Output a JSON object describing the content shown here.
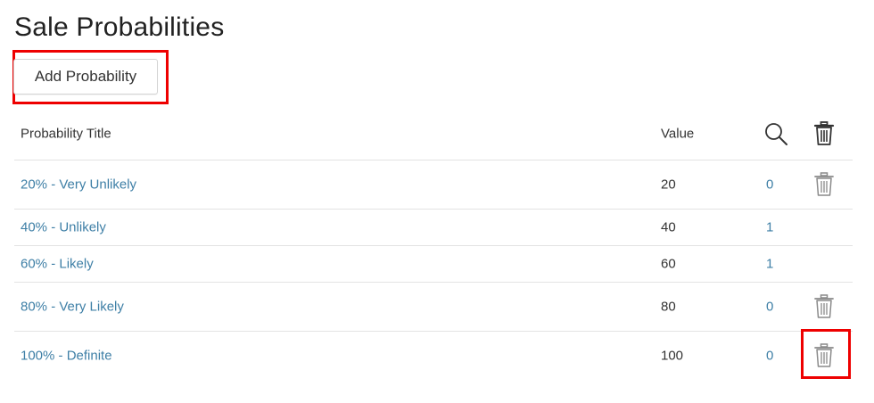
{
  "page": {
    "title": "Sale Probabilities"
  },
  "toolbar": {
    "add_label": "Add Probability"
  },
  "table": {
    "headers": {
      "title": "Probability Title",
      "value": "Value"
    },
    "rows": [
      {
        "title": "20% - Very Unlikely",
        "value": "20",
        "count": "0",
        "deletable": true
      },
      {
        "title": "40% - Unlikely",
        "value": "40",
        "count": "1",
        "deletable": false
      },
      {
        "title": "60% - Likely",
        "value": "60",
        "count": "1",
        "deletable": false
      },
      {
        "title": "80% - Very Likely",
        "value": "80",
        "count": "0",
        "deletable": true
      },
      {
        "title": "100% - Definite",
        "value": "100",
        "count": "0",
        "deletable": true
      }
    ]
  },
  "icons": {
    "header_search": "search-icon",
    "header_delete": "trash-icon",
    "row_delete": "trash-icon"
  },
  "colors": {
    "link": "#3e7fa6",
    "highlight": "#ee0000"
  }
}
